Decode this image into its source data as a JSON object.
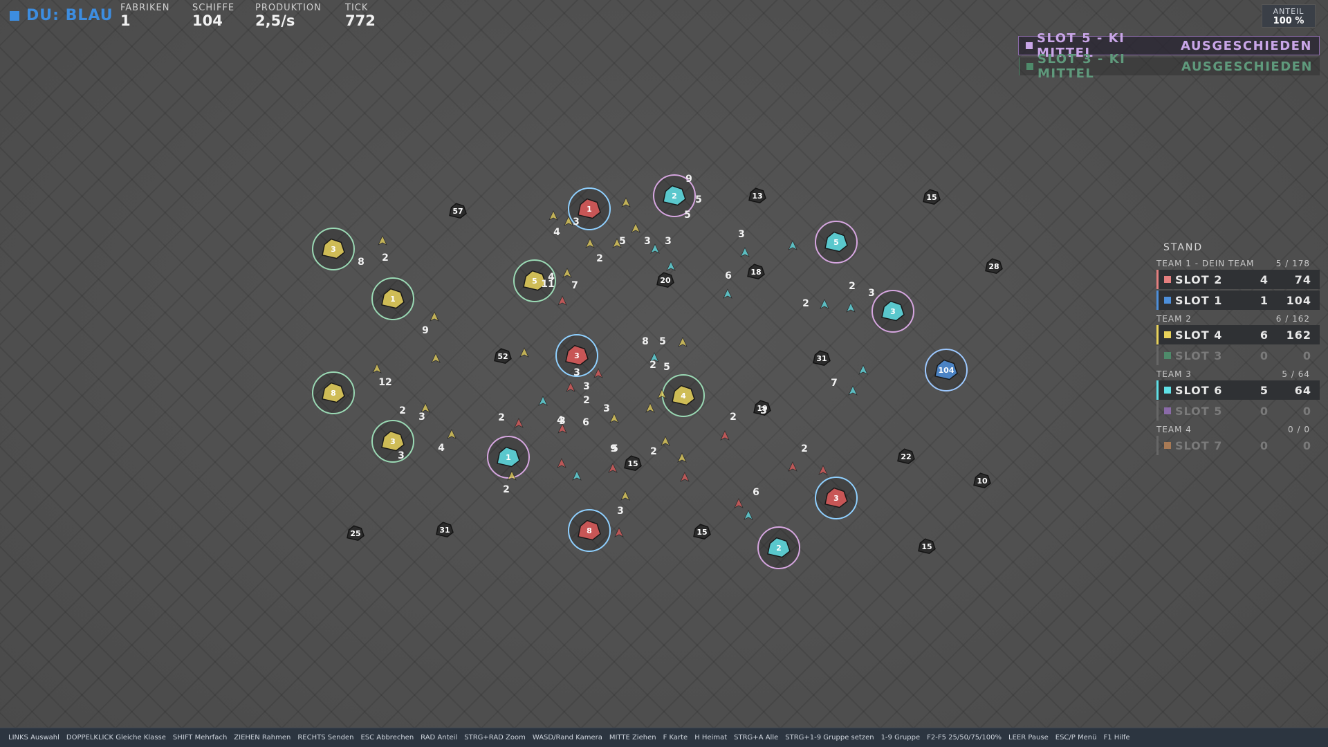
{
  "hud": {
    "player": "DU: BLAU",
    "player_color": "#3d8de0",
    "stats": [
      {
        "label": "FABRIKEN",
        "value": "1"
      },
      {
        "label": "SCHIFFE",
        "value": "104"
      },
      {
        "label": "PRODUKTION",
        "value": "2,5/s"
      },
      {
        "label": "TICK",
        "value": "772"
      }
    ],
    "share_label": "ANTEIL",
    "share_value": "100 %"
  },
  "notices": [
    {
      "text": "SLOT 5 - KI MITTEL",
      "status": "AUSGESCHIEDEN",
      "color": "#c9a6e8"
    },
    {
      "text": "SLOT 3 - KI MITTEL",
      "status": "AUSGESCHIEDEN",
      "color": "#6fa98c"
    }
  ],
  "standings": {
    "title": "STAND",
    "teams": [
      {
        "name": "TEAM 1 - DEIN TEAM",
        "score": "5 / 178",
        "slots": [
          {
            "name": "SLOT 2",
            "factories": "4",
            "ships": "74",
            "color": "#e57f7f",
            "active": true
          },
          {
            "name": "SLOT 1",
            "factories": "1",
            "ships": "104",
            "color": "#4d8fdb",
            "active": true
          }
        ]
      },
      {
        "name": "TEAM 2",
        "score": "6 / 162",
        "slots": [
          {
            "name": "SLOT 4",
            "factories": "6",
            "ships": "162",
            "color": "#e8d25a",
            "active": true
          },
          {
            "name": "SLOT 3",
            "factories": "0",
            "ships": "0",
            "color": "#4e8a6a",
            "active": false
          }
        ]
      },
      {
        "name": "TEAM 3",
        "score": "5 / 64",
        "slots": [
          {
            "name": "SLOT 6",
            "factories": "5",
            "ships": "64",
            "color": "#5fe0e6",
            "active": true
          },
          {
            "name": "SLOT 5",
            "factories": "0",
            "ships": "0",
            "color": "#8a6aa8",
            "active": false
          }
        ]
      },
      {
        "name": "TEAM 4",
        "score": "0 / 0",
        "slots": [
          {
            "name": "SLOT 7",
            "factories": "0",
            "ships": "0",
            "color": "#a87a55",
            "active": false
          }
        ]
      }
    ]
  },
  "map": {
    "factories": [
      {
        "label": "57",
        "owner": "neutral"
      },
      {
        "label": "1",
        "owner": "red"
      },
      {
        "label": "2",
        "owner": "teal"
      },
      {
        "label": "13",
        "owner": "neutral"
      },
      {
        "label": "15",
        "owner": "neutral"
      },
      {
        "label": "3",
        "owner": "yellow"
      },
      {
        "label": "5",
        "owner": "yellow"
      },
      {
        "label": "20",
        "owner": "neutral"
      },
      {
        "label": "18",
        "owner": "neutral"
      },
      {
        "label": "5",
        "owner": "teal"
      },
      {
        "label": "28",
        "owner": "neutral"
      },
      {
        "label": "1",
        "owner": "yellow"
      },
      {
        "label": "3",
        "owner": "teal"
      },
      {
        "label": "52",
        "owner": "neutral"
      },
      {
        "label": "3",
        "owner": "red"
      },
      {
        "label": "31",
        "owner": "neutral"
      },
      {
        "label": "104",
        "owner": "blue"
      },
      {
        "label": "8",
        "owner": "yellow"
      },
      {
        "label": "4",
        "owner": "yellow"
      },
      {
        "label": "19",
        "owner": "neutral"
      },
      {
        "label": "3",
        "owner": "yellow"
      },
      {
        "label": "1",
        "owner": "teal"
      },
      {
        "label": "15",
        "owner": "neutral"
      },
      {
        "label": "22",
        "owner": "neutral"
      },
      {
        "label": "10",
        "owner": "neutral"
      },
      {
        "label": "3",
        "owner": "red"
      },
      {
        "label": "25",
        "owner": "neutral"
      },
      {
        "label": "31",
        "owner": "neutral"
      },
      {
        "label": "8",
        "owner": "red"
      },
      {
        "label": "15",
        "owner": "neutral"
      },
      {
        "label": "2",
        "owner": "teal"
      },
      {
        "label": "15",
        "owner": "neutral"
      }
    ],
    "fleet_labels": [
      "9",
      "5",
      "5",
      "4",
      "3",
      "2",
      "5",
      "3",
      "3",
      "8",
      "2",
      "3",
      "4",
      "11",
      "7",
      "6",
      "2",
      "2",
      "3",
      "9",
      "8",
      "5",
      "2",
      "5",
      "3",
      "12",
      "3",
      "3",
      "2",
      "3",
      "3",
      "6",
      "7",
      "2",
      "4",
      "2",
      "9",
      "4",
      "2",
      "5",
      "2",
      "2",
      "3",
      "3",
      "2",
      "3",
      "6"
    ]
  },
  "helpbar": [
    "LINKS Auswahl",
    "DOPPELKLICK Gleiche Klasse",
    "SHIFT Mehrfach",
    "ZIEHEN Rahmen",
    "RECHTS Senden",
    "ESC Abbrechen",
    "RAD Anteil",
    "STRG+RAD Zoom",
    "WASD/Rand Kamera",
    "MITTE Ziehen",
    "F Karte",
    "H Heimat",
    "STRG+A Alle",
    "STRG+1-9 Gruppe setzen",
    "1-9 Gruppe",
    "F2-F5 25/50/75/100%",
    "LEER Pause",
    "ESC/P Menü",
    "F1 Hilfe"
  ],
  "colors": {
    "red": "#e05a5a",
    "teal": "#5fe0e6",
    "yellow": "#e8d25a",
    "blue": "#4d8fdb",
    "neutral": "#2a2a2a",
    "red_ring": "#8fd0ff",
    "yellow_ring": "#9ad9b4",
    "teal_ring": "#d6a6e0"
  }
}
